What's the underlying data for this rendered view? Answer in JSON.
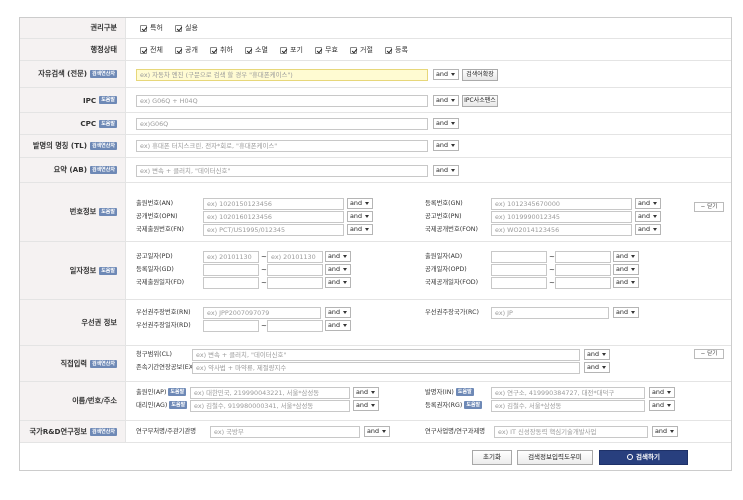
{
  "labels": {
    "status_mgmt": "권리구분",
    "admin_status": "행정상태",
    "free_search": "자유검색 (전문)",
    "ipc": "IPC",
    "cpc": "CPC",
    "title": "발명의 명칭 (TL)",
    "abstract": "요약 (AB)",
    "number_info": "번호정보",
    "date_info": "일자정보",
    "priority_info": "우선권 정보",
    "direct_input": "직접입력",
    "name_info": "이름/번호/주소",
    "rnd_info": "국가R&D연구정보"
  },
  "badges": {
    "syntax": "검색연산자",
    "info": "도움말"
  },
  "rights": [
    "특허",
    "실용"
  ],
  "admin": [
    "전체",
    "공개",
    "취하",
    "소멸",
    "포기",
    "무효",
    "거절",
    "등록"
  ],
  "op": "and",
  "free_search": {
    "placeholder": "ex) 자동차 엔진 (구문으로 검색 할 경우 \"휴대폰케이스\")",
    "expand": "검색어확장"
  },
  "ipc": {
    "placeholder": "ex) G06Q + H04Q",
    "lookup": "IPC사소팬스"
  },
  "cpc": {
    "placeholder": "ex)G06Q"
  },
  "title": {
    "placeholder": "ex) 휴대폰 터치스크린, 전자*회로, \"휴대폰케이스\""
  },
  "abstract": {
    "placeholder": "ex) 변속 + 클러치, \"데이터신호\""
  },
  "numbers": {
    "left": [
      {
        "label": "출원번호(AN)",
        "ph": "ex) 1020150123456"
      },
      {
        "label": "공개번호(OPN)",
        "ph": "ex) 1020160123456"
      },
      {
        "label": "국제출원번호(FN)",
        "ph": "ex) PCT/US1995/012345"
      }
    ],
    "right": [
      {
        "label": "등록번호(GN)",
        "ph": "ex) 1012345670000"
      },
      {
        "label": "공고번호(PN)",
        "ph": "ex) 1019990012345"
      },
      {
        "label": "국제공개번호(FON)",
        "ph": "ex) WO2014123456"
      }
    ],
    "fold": "− 닫기"
  },
  "dates": {
    "left": [
      {
        "label": "공고일자(PD)",
        "from": "ex) 20101130",
        "to": "ex) 20101130"
      },
      {
        "label": "등록일자(GD)",
        "from": "",
        "to": ""
      },
      {
        "label": "국제출원일자(FD)",
        "from": "",
        "to": ""
      }
    ],
    "right": [
      {
        "label": "출원일자(AD)"
      },
      {
        "label": "공개일자(OPD)"
      },
      {
        "label": "국제공개일자(FOD)"
      }
    ]
  },
  "priority": {
    "left": [
      {
        "label": "우선권주장번호(RN)",
        "ph": "ex) JPP2007097079"
      },
      {
        "label": "우선권주장일자(RD)",
        "ph": ""
      }
    ],
    "right_label": "우선권주장국가(RC)",
    "right_ph": "ex) JP"
  },
  "direct": {
    "rows": [
      {
        "label": "청구범위(CL)",
        "ph": "ex) 변속 + 클러치, \"데이터신호\""
      },
      {
        "label": "존속기간연장공보(EX)",
        "ph": "ex) 약사법 + 마약류, 제절량지수"
      }
    ],
    "fold": "− 닫기"
  },
  "names": {
    "left": [
      {
        "label": "출원인(AP)",
        "ph": "ex) 대한민국, 219990043221, 서울*삼성동"
      },
      {
        "label": "대리인(AG)",
        "ph": "ex) 김철수, 919980000341, 서울*삼성동"
      }
    ],
    "right": [
      {
        "label": "발명자(IN)",
        "ph": "ex) 연구소, 419990384727, 대전*대덕구"
      },
      {
        "label": "등록권자(RG)",
        "ph": "ex) 김철수, 서울*삼성동"
      }
    ]
  },
  "rnd": {
    "left_label": "연구부처명/주관기관명",
    "left_ph": "ex) 국방부",
    "right_label": "연구사업명/연구과제명",
    "right_ph": "ex) IT 신성장동력 핵심기술개발사업"
  },
  "footer": {
    "reset": "초기화",
    "save": "검색정보입력도우미",
    "search": "검색하기"
  }
}
